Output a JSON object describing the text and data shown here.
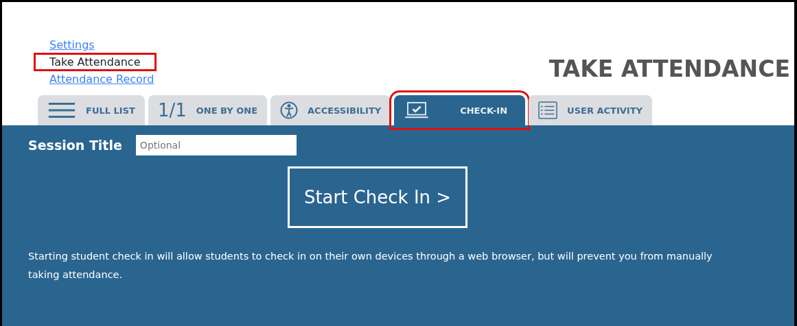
{
  "nav": [
    {
      "label": "Settings",
      "current": false,
      "highlighted": false
    },
    {
      "label": "Take Attendance",
      "current": true,
      "highlighted": true
    },
    {
      "label": "Attendance Record",
      "current": false,
      "highlighted": false
    }
  ],
  "page_title": "TAKE ATTENDANCE",
  "tabs": [
    {
      "kind": "menu",
      "label": "FULL LIST",
      "selected": false,
      "highlighted": false
    },
    {
      "kind": "fraction",
      "prefix": "1/1",
      "label": "ONE BY ONE",
      "selected": false,
      "highlighted": false
    },
    {
      "kind": "accessibility",
      "label": "ACCESSIBILITY",
      "selected": false,
      "highlighted": false
    },
    {
      "kind": "laptop",
      "label": "CHECK-IN",
      "selected": true,
      "highlighted": true
    },
    {
      "kind": "list",
      "label": "USER ACTIVITY",
      "selected": false,
      "highlighted": false
    }
  ],
  "session_title": {
    "label": "Session Title",
    "placeholder": "Optional"
  },
  "start_button": "Start Check In >",
  "notice": "Starting student check in will allow students to check in on their own devices through a web browser, but will prevent you from manually taking attendance."
}
